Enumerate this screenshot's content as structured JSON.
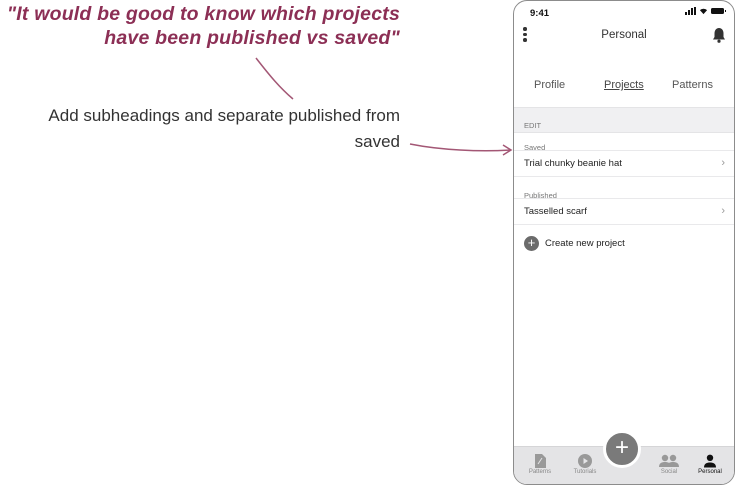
{
  "annotation": {
    "quote_line1": "\"It would be good to know which projects",
    "quote_line2": "have been published vs saved\"",
    "note_line1": "Add subheadings and separate published from",
    "note_line2": "saved"
  },
  "status_bar": {
    "time": "9:41"
  },
  "header": {
    "title": "Personal"
  },
  "tabs": [
    {
      "label": "Profile"
    },
    {
      "label": "Projects",
      "active": true
    },
    {
      "label": "Patterns"
    }
  ],
  "edit_label": "EDIT",
  "sections": [
    {
      "heading": "Saved",
      "items": [
        {
          "label": "Trial chunky beanie hat"
        }
      ]
    },
    {
      "heading": "Published",
      "items": [
        {
          "label": "Tasselled scarf"
        }
      ]
    }
  ],
  "create_label": "Create new project",
  "bottom_nav": [
    {
      "label": "Patterns",
      "icon": "document-icon"
    },
    {
      "label": "Tutorials",
      "icon": "play-icon"
    },
    {
      "label": "Social",
      "icon": "people-icon"
    },
    {
      "label": "Personal",
      "icon": "person-icon",
      "active": true
    }
  ],
  "colors": {
    "quote": "#8c2f55",
    "arrow": "#a35775",
    "nav_bg": "#e4e4e6",
    "fab": "#7a7a7a"
  }
}
